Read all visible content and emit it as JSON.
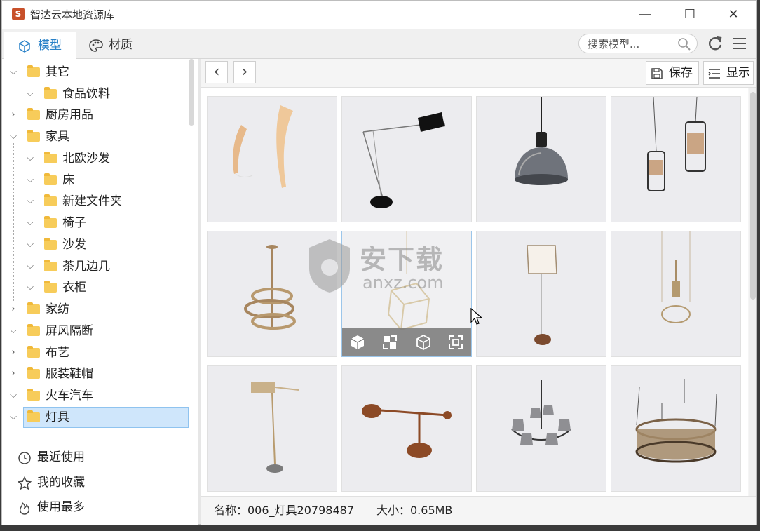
{
  "window": {
    "title": "智达云本地资源库",
    "app_icon_glyph": "S",
    "controls": [
      "—",
      "☐",
      "✕"
    ]
  },
  "tabs": [
    {
      "label": "模型",
      "icon": "cube-icon",
      "active": true
    },
    {
      "label": "材质",
      "icon": "palette-icon",
      "active": false
    }
  ],
  "search": {
    "placeholder": "搜索模型..."
  },
  "tree": [
    {
      "label": "其它",
      "level": 0,
      "expanded": true
    },
    {
      "label": "食品饮料",
      "level": 1,
      "expanded": true
    },
    {
      "label": "厨房用品",
      "level": 0,
      "expanded": false
    },
    {
      "label": "家具",
      "level": 0,
      "expanded": true
    },
    {
      "label": "北欧沙发",
      "level": 1,
      "expanded": true
    },
    {
      "label": "床",
      "level": 1,
      "expanded": true
    },
    {
      "label": "新建文件夹",
      "level": 1,
      "expanded": true
    },
    {
      "label": "椅子",
      "level": 1,
      "expanded": true
    },
    {
      "label": "沙发",
      "level": 1,
      "expanded": true
    },
    {
      "label": "茶几边几",
      "level": 1,
      "expanded": true
    },
    {
      "label": "衣柜",
      "level": 1,
      "expanded": true
    },
    {
      "label": "家纺",
      "level": 0,
      "expanded": false
    },
    {
      "label": "屏风隔断",
      "level": 0,
      "expanded": true
    },
    {
      "label": "布艺",
      "level": 0,
      "expanded": false
    },
    {
      "label": "服装鞋帽",
      "level": 0,
      "expanded": false
    },
    {
      "label": "火车汽车",
      "level": 0,
      "expanded": true
    },
    {
      "label": "灯具",
      "level": 0,
      "expanded": true,
      "selected": true
    }
  ],
  "quick_links": [
    {
      "label": "最近使用",
      "icon": "clock-icon"
    },
    {
      "label": "我的收藏",
      "icon": "star-icon"
    },
    {
      "label": "使用最多",
      "icon": "fire-icon"
    }
  ],
  "toolbar": {
    "back": "‹",
    "forward": "›",
    "save_label": "保存",
    "display_label": "显示"
  },
  "thumbnails": [
    {
      "name": "wall-lamp-pair",
      "art": "sconce"
    },
    {
      "name": "floor-lamp-arm",
      "art": "armlamp"
    },
    {
      "name": "pendant-dome",
      "art": "dome"
    },
    {
      "name": "pendant-lantern-pair",
      "art": "lanterns"
    },
    {
      "name": "ring-chandelier",
      "art": "rings"
    },
    {
      "name": "cube-chandelier",
      "art": "cube",
      "hover": true
    },
    {
      "name": "glass-floor-lamp",
      "art": "glassfloor"
    },
    {
      "name": "cord-pendant",
      "art": "cordpendant"
    },
    {
      "name": "brass-floor-lamp",
      "art": "brassfloor"
    },
    {
      "name": "copper-floor-lamp",
      "art": "copperfloor"
    },
    {
      "name": "shade-chandelier",
      "art": "shades"
    },
    {
      "name": "drum-pendant",
      "art": "drum"
    }
  ],
  "card_actions": [
    "cube-solid-icon",
    "replace-icon",
    "cube-outline-icon",
    "fit-icon"
  ],
  "watermark": {
    "title": "安下载",
    "sub": "anxz.com"
  },
  "status": {
    "name": "名称：006_灯具20798487",
    "size": "大小：0.65MB"
  }
}
